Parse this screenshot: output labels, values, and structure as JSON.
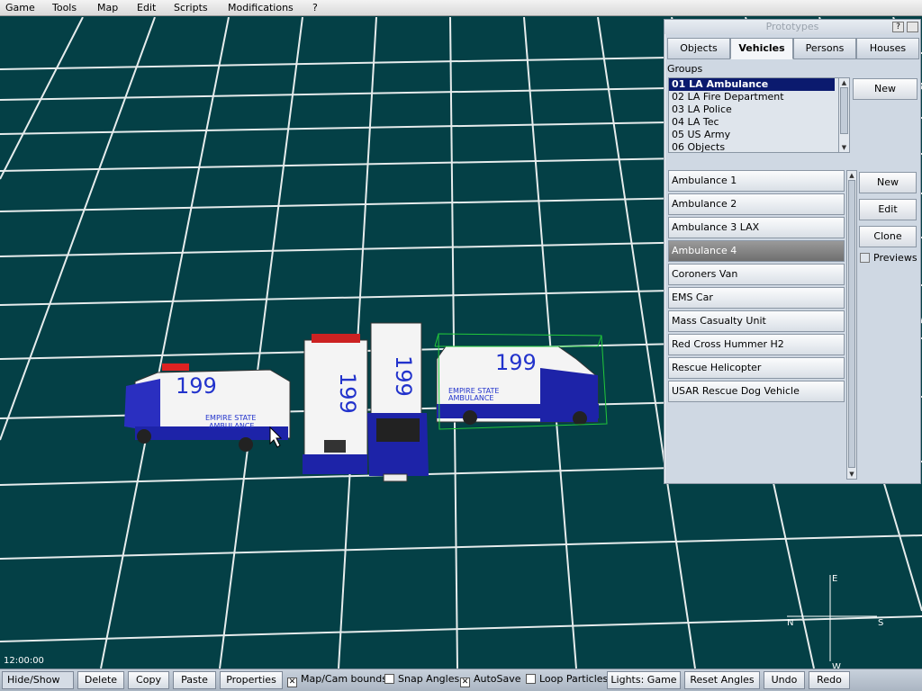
{
  "menu": [
    "Game",
    "Tools",
    "Map",
    "Edit",
    "Scripts",
    "Modifications",
    "?"
  ],
  "viewport": {
    "vehicle_number": "199",
    "van_side_text": "EMPIRE STATE AMBULANCE",
    "compass": {
      "e": "E",
      "s": "S",
      "w": "W",
      "n": "N"
    },
    "time": "12:00:00"
  },
  "panel": {
    "title": "Prototypes",
    "help_label": "?",
    "tabs": [
      "Objects",
      "Vehicles",
      "Persons",
      "Houses"
    ],
    "active_tab": "Vehicles",
    "groups_label": "Groups",
    "groups": [
      "01 LA Ambulance",
      "02 LA Fire Department",
      "03 LA Police",
      "04 LA Tec",
      "05 US Army",
      "06 Objects"
    ],
    "selected_group": "01 LA Ambulance",
    "groups_new_label": "New",
    "vehicles": [
      "Ambulance 1",
      "Ambulance 2",
      "Ambulance 3 LAX",
      "Ambulance 4",
      "Coroners Van",
      "EMS Car",
      "Mass Casualty Unit",
      "Red Cross Hummer H2",
      "Rescue Helicopter",
      "USAR Rescue Dog Vehicle"
    ],
    "selected_vehicle": "Ambulance 4",
    "new_label": "New",
    "edit_label": "Edit",
    "clone_label": "Clone",
    "previews_label": "Previews"
  },
  "toolbar": {
    "hide_show": "Hide/Show",
    "delete": "Delete",
    "copy": "Copy",
    "paste": "Paste",
    "properties": "Properties",
    "map_cam_bounds": "Map/Cam bounds",
    "snap_angles": "Snap Angles",
    "autosave": "AutoSave",
    "loop_particles": "Loop Particles",
    "lights": "Lights: Game",
    "reset_angles": "Reset Angles",
    "undo": "Undo",
    "redo": "Redo",
    "checks": {
      "map_cam_bounds": true,
      "snap_angles": false,
      "autosave": true,
      "loop_particles": false
    }
  },
  "colors": {
    "grid_line": "#ffffff",
    "ground": "#044046",
    "selection_box": "#22c83a",
    "selected_group_bg": "#0b1a6e"
  }
}
